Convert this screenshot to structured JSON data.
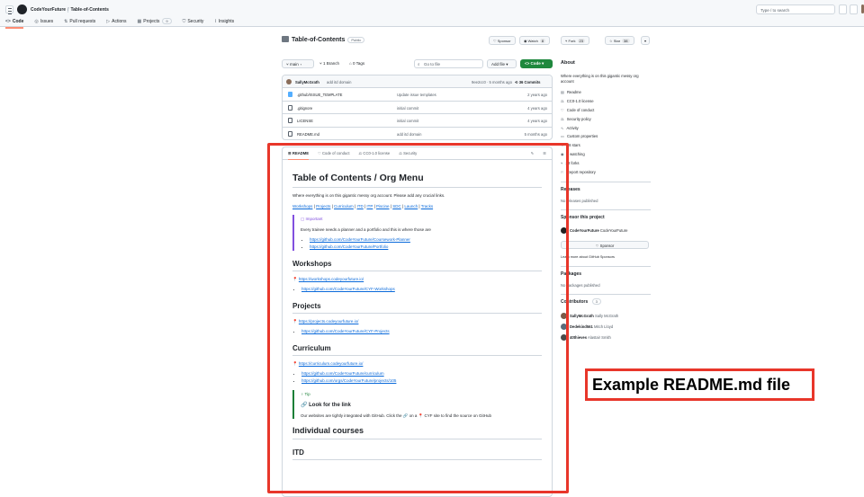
{
  "header": {
    "org": "CodeYourFuture",
    "sep": "/",
    "repo": "Table-of-Contents",
    "search_placeholder": "Type / to search",
    "tabs": [
      {
        "icon": "code-icon",
        "glyph": "<>",
        "label": "Code"
      },
      {
        "icon": "issue-icon",
        "glyph": "◎",
        "label": "Issues"
      },
      {
        "icon": "pull-request-icon",
        "glyph": "⇅",
        "label": "Pull requests"
      },
      {
        "icon": "actions-icon",
        "glyph": "▷",
        "label": "Actions"
      },
      {
        "icon": "projects-icon",
        "glyph": "▦",
        "label": "Projects",
        "count": "9"
      },
      {
        "icon": "shield-icon",
        "glyph": "⛉",
        "label": "Security"
      },
      {
        "icon": "graph-icon",
        "glyph": "⌇",
        "label": "Insights"
      }
    ]
  },
  "repo": {
    "title": "Table-of-Contents",
    "visibility": "Public",
    "sponsor_label": "Sponsor",
    "watch_label": "Watch",
    "watch_count": "8",
    "fork_label": "Fork",
    "fork_count": "23",
    "star_label": "Star",
    "star_count": "38"
  },
  "branchbar": {
    "branch": "main",
    "branches": "1 Branch",
    "tags": "0 Tags",
    "goto_placeholder": "Go to file",
    "add_file": "Add file",
    "code": "Code"
  },
  "commit": {
    "author": "SallyMcGrath",
    "message": "add itd domain",
    "hash": "9ee2cc0 · 5 months ago",
    "count": "36 Commits"
  },
  "files": [
    {
      "name": ".github/ISSUE_TEMPLATE",
      "msg": "Update issue templates",
      "date": "2 years ago",
      "dir": true
    },
    {
      "name": ".gitignore",
      "msg": "initial commit",
      "date": "4 years ago",
      "dir": false
    },
    {
      "name": "LICENSE",
      "msg": "initial commit",
      "date": "4 years ago",
      "dir": false
    },
    {
      "name": "README.md",
      "msg": "add itd domain",
      "date": "5 months ago",
      "dir": false
    }
  ],
  "readme": {
    "tabs": [
      "README",
      "Code of conduct",
      "CC0-1.0 license",
      "Security"
    ],
    "title": "Table of Contents / Org Menu",
    "intro": "Where everything is on this gigantic messy org account. Please add any crucial links.",
    "nav_links": [
      "Workshops",
      "Projects",
      "Curriculum",
      "ITD",
      "ITP",
      "Piscine",
      "SDC",
      "Launch",
      "Tracks"
    ],
    "important_label": "Important",
    "important_text": "Every trainee needs a planner and a portfolio and this is where those are",
    "important_links": [
      "https://github.com/CodeYourFuture/Coursework-Planner",
      "https://github.com/CodeYourFuture/Portfolio"
    ],
    "workshops_h": "Workshops",
    "workshops_site": "https://workshops.codeyourfuture.io/",
    "workshops_link": "https://github.com/CodeYourFuture/CYF-Workshops",
    "projects_h": "Projects",
    "projects_site": "https://projects.codeyourfuture.io/",
    "projects_link": "https://github.com/CodeYourFuture/CYF-Projects",
    "curriculum_h": "Curriculum",
    "curriculum_site": "https://curriculum.codeyourfuture.io/",
    "curriculum_links": [
      "https://github.com/CodeYourFuture/curriculum",
      "https://github.com/orgs/CodeYourFuture/projects/105"
    ],
    "tip_label": "Tip",
    "tip_heading": "Look for the link",
    "tip_text": "Our websites are tightly integrated with GitHub. Click the 🔗 on a 📍 CYF site to find the source on GitHub",
    "courses_h": "Individual courses",
    "itd_h": "ITD"
  },
  "sidebar": {
    "about_h": "About",
    "about_text": "Where everything is on this gigantic messy org account",
    "links": [
      {
        "icon": "book-icon",
        "label": "Readme"
      },
      {
        "icon": "law-icon",
        "label": "CC0-1.0 license"
      },
      {
        "icon": "heart-icon",
        "label": "Code of conduct"
      },
      {
        "icon": "scale-icon",
        "label": "Security policy"
      },
      {
        "icon": "pulse-icon",
        "label": "Activity"
      },
      {
        "icon": "note-icon",
        "label": "Custom properties"
      },
      {
        "icon": "star-icon",
        "label": "38 stars"
      },
      {
        "icon": "eye-icon",
        "label": "8 watching"
      },
      {
        "icon": "fork-icon",
        "label": "23 forks"
      },
      {
        "icon": "report-icon",
        "label": "Report repository"
      }
    ],
    "releases_h": "Releases",
    "releases_text": "No releases published",
    "sponsor_h": "Sponsor this project",
    "sponsor_name": "CodeYourFuture",
    "sponsor_handle": "CodeYourFuture",
    "sponsor_btn": "Sponsor",
    "sponsor_learn": "Learn more about GitHub Sponsors",
    "packages_h": "Packages",
    "packages_text": "No packages published",
    "contributors_h": "Contributors",
    "contributors_count": "3",
    "contributors": [
      {
        "handle": "SallyMcGrath",
        "name": "Sally McGrath"
      },
      {
        "handle": "Dedekind561",
        "name": "Mitch Lloyd"
      },
      {
        "handle": "40thieves",
        "name": "Alastair Smith"
      }
    ]
  },
  "annotation": {
    "label": "Example README.md file"
  }
}
